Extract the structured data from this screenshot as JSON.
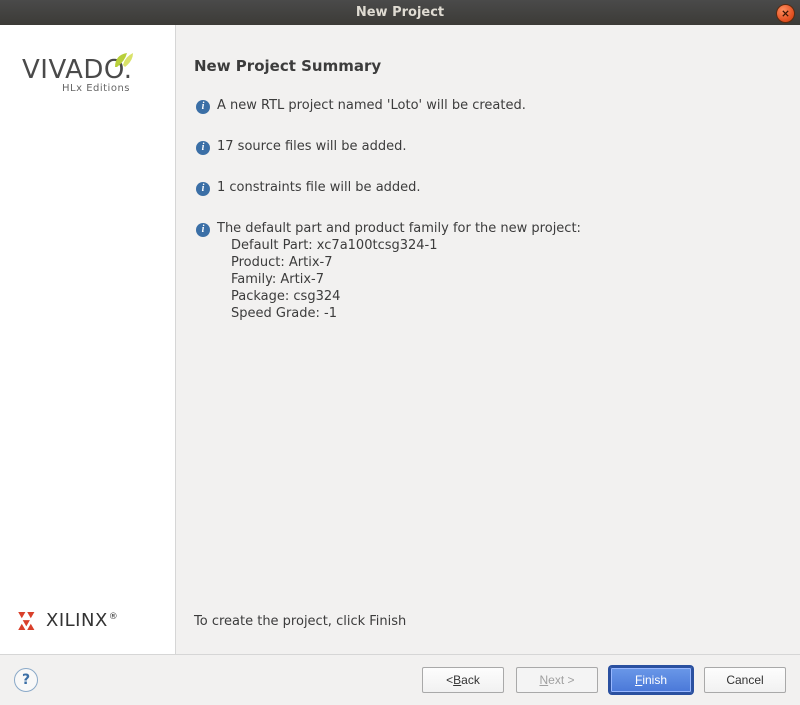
{
  "window": {
    "title": "New Project"
  },
  "branding": {
    "vivado": "VIVADO",
    "vivado_sub": "HLx Editions",
    "xilinx": "XILINX",
    "reg": "®",
    "dot": "."
  },
  "header": "New Project Summary",
  "bullets": {
    "b1": "A new RTL project named 'Loto' will be created.",
    "b2": "17 source files will be added.",
    "b3": "1 constraints file will be added.",
    "b4_intro": "The default part and product family for the new project:",
    "d_part": "Default Part: xc7a100tcsg324-1",
    "d_product": "Product: Artix-7",
    "d_family": "Family: Artix-7",
    "d_package": "Package: csg324",
    "d_speed": "Speed Grade: -1"
  },
  "hint": "To create the project, click Finish",
  "buttons": {
    "help": "?",
    "back_prefix": "< ",
    "back_m": "B",
    "back_suffix": "ack",
    "next_m": "N",
    "next_suffix": "ext >",
    "finish_m": "F",
    "finish_suffix": "inish",
    "cancel": "Cancel"
  }
}
